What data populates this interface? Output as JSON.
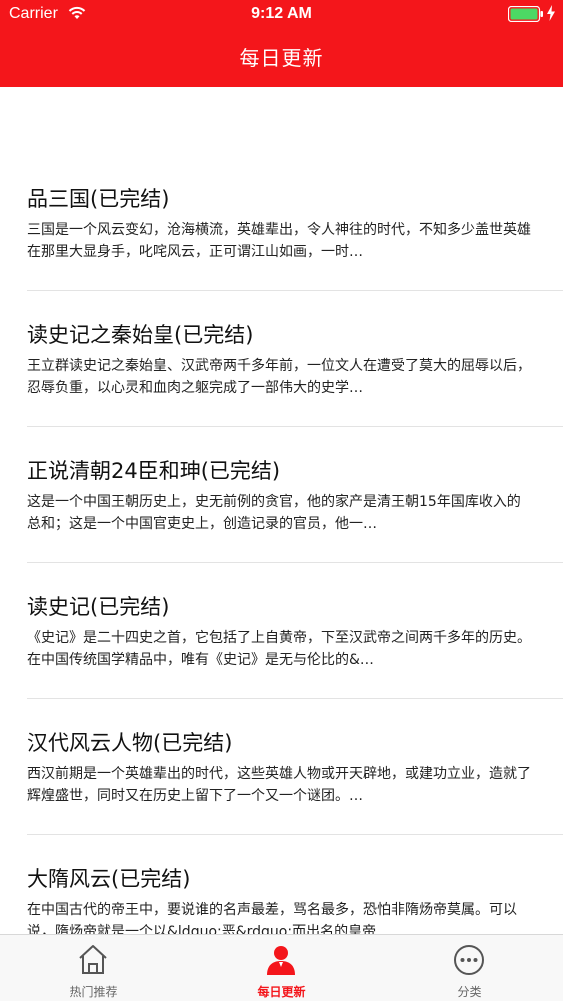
{
  "status_bar": {
    "carrier": "Carrier",
    "time": "9:12 AM"
  },
  "nav": {
    "title": "每日更新"
  },
  "colors": {
    "accent": "#f4161b",
    "battery": "#4cd964"
  },
  "list": {
    "items": [
      {
        "title": "品三国(已完结)",
        "description": "三国是一个风云变幻，沧海横流，英雄辈出，令人神往的时代，不知多少盖世英雄在那里大显身手，叱咤风云，正可谓江山如画，一时…"
      },
      {
        "title": "读史记之秦始皇(已完结)",
        "description": "王立群读史记之秦始皇、汉武帝两千多年前，一位文人在遭受了莫大的屈辱以后，忍辱负重，以心灵和血肉之躯完成了一部伟大的史学…"
      },
      {
        "title": "正说清朝24臣和珅(已完结)",
        "description": "这是一个中国王朝历史上，史无前例的贪官，他的家产是清王朝15年国库收入的 总和；这是一个中国官吏史上，创造记录的官员，他一…"
      },
      {
        "title": "读史记(已完结)",
        "description": "《史记》是二十四史之首，它包括了上自黄帝，下至汉武帝之间两千多年的历史。在中国传统国学精品中，唯有《史记》是无与伦比的&…"
      },
      {
        "title": "汉代风云人物(已完结)",
        "description": "西汉前期是一个英雄辈出的时代，这些英雄人物或开天辟地，或建功立业，造就了辉煌盛世，同时又在历史上留下了一个又一个谜团。…"
      },
      {
        "title": "大隋风云(已完结)",
        "description": "在中国古代的帝王中，要说谁的名声最差，骂名最多，恐怕非隋炀帝莫属。可以说，隋炀帝就是一个以&ldquo;恶&rdquo;而出名的皇帝…"
      }
    ]
  },
  "tabbar": {
    "tabs": [
      {
        "label": "热门推荐",
        "icon": "home-icon"
      },
      {
        "label": "每日更新",
        "icon": "user-icon"
      },
      {
        "label": "分类",
        "icon": "more-icon"
      }
    ],
    "active_index": 1
  }
}
